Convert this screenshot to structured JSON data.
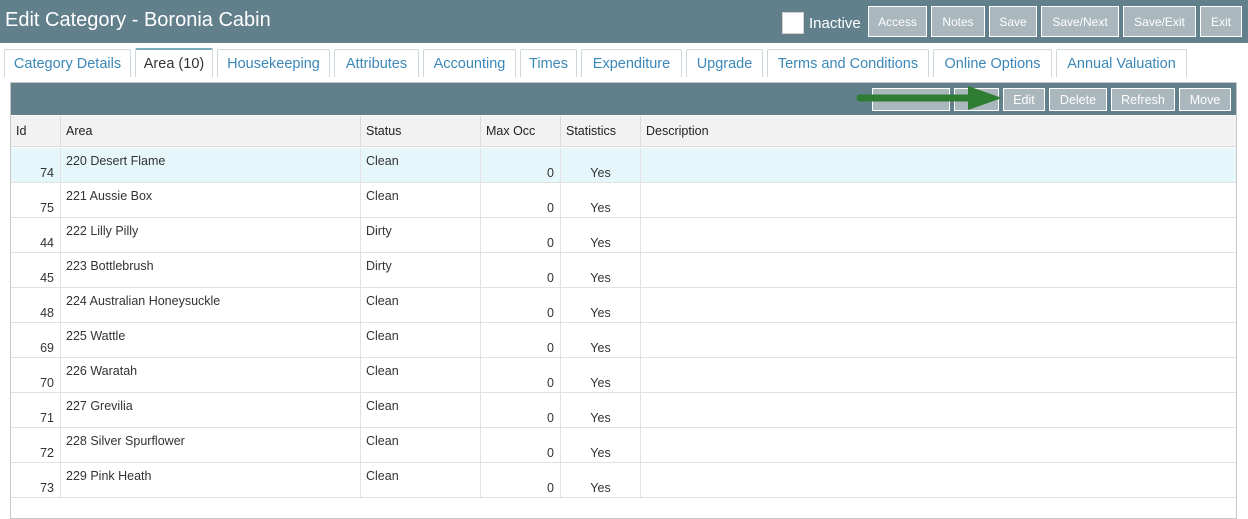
{
  "header": {
    "title": "Edit Category - Boronia Cabin",
    "inactive_label": "Inactive",
    "buttons": [
      "Access",
      "Notes",
      "Save",
      "Save/Next",
      "Save/Exit",
      "Exit"
    ]
  },
  "tabs": [
    {
      "label": "Category Details",
      "active": false
    },
    {
      "label": "Area (10)",
      "active": true
    },
    {
      "label": "Housekeeping",
      "active": false
    },
    {
      "label": "Attributes",
      "active": false
    },
    {
      "label": "Accounting",
      "active": false
    },
    {
      "label": "Times",
      "active": false
    },
    {
      "label": "Expenditure",
      "active": false
    },
    {
      "label": "Upgrade",
      "active": false
    },
    {
      "label": "Terms and Conditions",
      "active": false
    },
    {
      "label": "Online Options",
      "active": false
    },
    {
      "label": "Annual Valuation",
      "active": false
    }
  ],
  "toolbar": {
    "edit_label": "Edit",
    "delete_label": "Delete",
    "refresh_label": "Refresh",
    "move_label": "Move"
  },
  "table": {
    "columns": [
      "Id",
      "Area",
      "Status",
      "Max Occ",
      "Statistics",
      "Description"
    ],
    "rows": [
      {
        "id": "74",
        "area": "220 Desert Flame",
        "status": "Clean",
        "max_occ": "0",
        "statistics": "Yes",
        "description": ""
      },
      {
        "id": "75",
        "area": "221 Aussie Box",
        "status": "Clean",
        "max_occ": "0",
        "statistics": "Yes",
        "description": ""
      },
      {
        "id": "44",
        "area": "222 Lilly Pilly",
        "status": "Dirty",
        "max_occ": "0",
        "statistics": "Yes",
        "description": ""
      },
      {
        "id": "45",
        "area": "223 Bottlebrush",
        "status": "Dirty",
        "max_occ": "0",
        "statistics": "Yes",
        "description": ""
      },
      {
        "id": "48",
        "area": "224 Australian Honeysuckle",
        "status": "Clean",
        "max_occ": "0",
        "statistics": "Yes",
        "description": ""
      },
      {
        "id": "69",
        "area": "225 Wattle",
        "status": "Clean",
        "max_occ": "0",
        "statistics": "Yes",
        "description": ""
      },
      {
        "id": "70",
        "area": "226 Waratah",
        "status": "Clean",
        "max_occ": "0",
        "statistics": "Yes",
        "description": ""
      },
      {
        "id": "71",
        "area": "227 Grevilia",
        "status": "Clean",
        "max_occ": "0",
        "statistics": "Yes",
        "description": ""
      },
      {
        "id": "72",
        "area": "228 Silver Spurflower",
        "status": "Clean",
        "max_occ": "0",
        "statistics": "Yes",
        "description": ""
      },
      {
        "id": "73",
        "area": "229 Pink Heath",
        "status": "Clean",
        "max_occ": "0",
        "statistics": "Yes",
        "description": ""
      }
    ]
  },
  "colors": {
    "header_bg": "#627f8c",
    "button_bg": "#aab7bd",
    "tab_link": "#3a87b8",
    "selected_row": "#e6f7fc",
    "arrow": "#2e7d32"
  }
}
